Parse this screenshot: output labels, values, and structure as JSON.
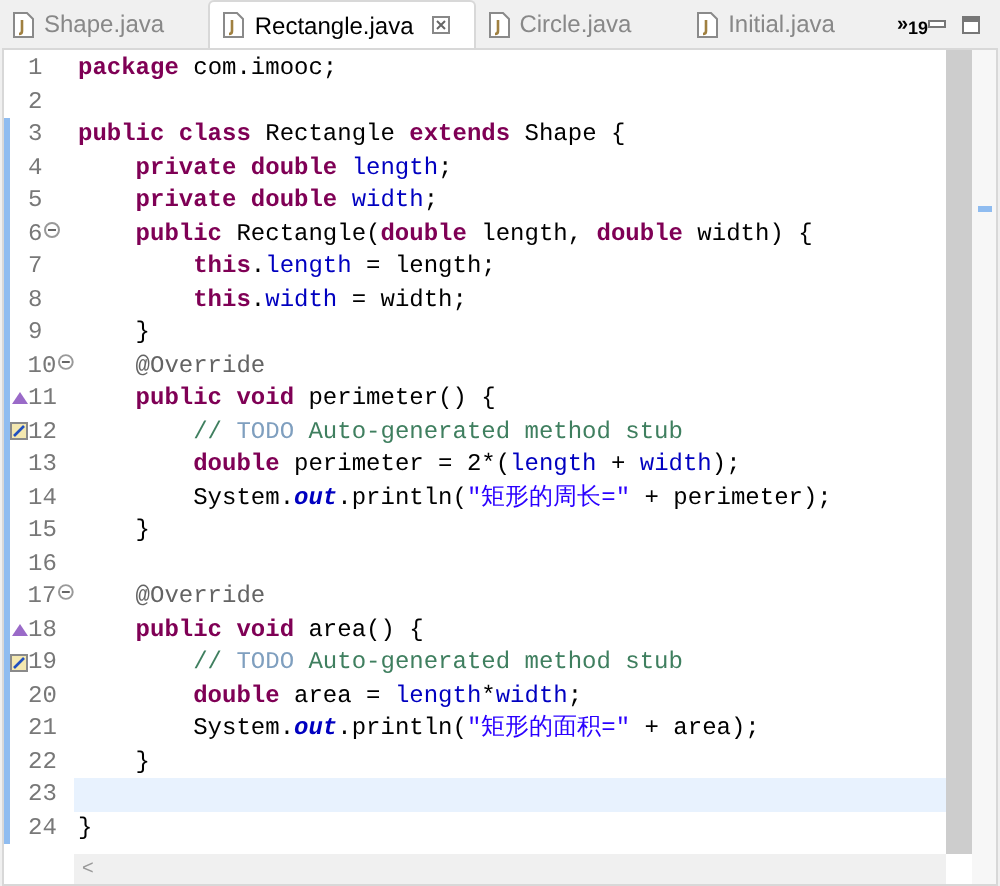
{
  "tabs": [
    {
      "label": "Shape.java",
      "selected": false,
      "closable": false
    },
    {
      "label": "Rectangle.java",
      "selected": true,
      "closable": true
    },
    {
      "label": "Circle.java",
      "selected": false,
      "closable": false
    },
    {
      "label": "Initial.java",
      "selected": false,
      "closable": false
    }
  ],
  "overflow": {
    "symbol": "»",
    "count": "19"
  },
  "lines": [
    {
      "number": "1",
      "foldable": false,
      "changed": false,
      "current": false,
      "tokens": [
        {
          "kind": "kw",
          "text": "package"
        },
        {
          "kind": "plain",
          "text": " com.imooc;"
        }
      ]
    },
    {
      "number": "2",
      "foldable": false,
      "changed": false,
      "current": false
    },
    {
      "number": "3",
      "foldable": false,
      "changed": true,
      "current": false,
      "tokens": [
        {
          "kind": "kw",
          "text": "public class"
        },
        {
          "kind": "plain",
          "text": " Rectangle "
        },
        {
          "kind": "kw",
          "text": "extends"
        },
        {
          "kind": "plain",
          "text": " Shape {"
        }
      ]
    },
    {
      "number": "4",
      "foldable": false,
      "changed": true,
      "current": false,
      "tokens": [
        {
          "kind": "kw",
          "text": "    private double"
        },
        {
          "kind": "field",
          "text": " length"
        },
        {
          "kind": "plain",
          "text": ";"
        }
      ]
    },
    {
      "number": "5",
      "foldable": false,
      "changed": true,
      "current": false,
      "tokens": [
        {
          "kind": "kw",
          "text": "    private double"
        },
        {
          "kind": "field",
          "text": " width"
        },
        {
          "kind": "plain",
          "text": ";"
        }
      ]
    },
    {
      "number": "6",
      "foldable": true,
      "changed": true,
      "current": false,
      "tokens": [
        {
          "kind": "kw",
          "text": "    public"
        },
        {
          "kind": "plain",
          "text": " Rectangle("
        },
        {
          "kind": "kw",
          "text": "double"
        },
        {
          "kind": "plain",
          "text": " length, "
        },
        {
          "kind": "kw",
          "text": "double"
        },
        {
          "kind": "plain",
          "text": " width) {"
        }
      ]
    },
    {
      "number": "7",
      "foldable": false,
      "changed": true,
      "current": false,
      "tokens": [
        {
          "kind": "kw",
          "text": "        this"
        },
        {
          "kind": "plain",
          "text": "."
        },
        {
          "kind": "field",
          "text": "length"
        },
        {
          "kind": "plain",
          "text": " = length;"
        }
      ]
    },
    {
      "number": "8",
      "foldable": false,
      "changed": true,
      "current": false,
      "tokens": [
        {
          "kind": "kw",
          "text": "        this"
        },
        {
          "kind": "plain",
          "text": "."
        },
        {
          "kind": "field",
          "text": "width"
        },
        {
          "kind": "plain",
          "text": " = width;"
        }
      ]
    },
    {
      "number": "9",
      "foldable": false,
      "changed": true,
      "current": false,
      "tokens": [
        {
          "kind": "plain",
          "text": "    }"
        }
      ]
    },
    {
      "number": "10",
      "foldable": true,
      "changed": true,
      "current": false,
      "tokens": [
        {
          "kind": "annotation",
          "text": "    @Override"
        }
      ]
    },
    {
      "number": "11",
      "foldable": false,
      "kind": "override",
      "changed": true,
      "current": false,
      "tokens": [
        {
          "kind": "kw",
          "text": "    public void"
        },
        {
          "kind": "plain",
          "text": " perimeter() {"
        }
      ]
    },
    {
      "number": "12",
      "foldable": false,
      "kind": "task",
      "changed": true,
      "current": false,
      "tokens": [
        {
          "kind": "comment",
          "text": "        //"
        },
        {
          "kind": "todo",
          "text": " TODO"
        },
        {
          "kind": "comment",
          "text": " Auto-generated method stub"
        }
      ]
    },
    {
      "number": "13",
      "foldable": false,
      "changed": true,
      "current": false,
      "tokens": [
        {
          "kind": "kw",
          "text": "        double"
        },
        {
          "kind": "plain",
          "text": " perimeter = 2*("
        },
        {
          "kind": "field",
          "text": "length"
        },
        {
          "kind": "plain",
          "text": " + "
        },
        {
          "kind": "field",
          "text": "width"
        },
        {
          "kind": "plain",
          "text": ");"
        }
      ]
    },
    {
      "number": "14",
      "foldable": false,
      "changed": true,
      "current": false,
      "tokens": [
        {
          "kind": "plain",
          "text": "        System."
        },
        {
          "kind": "static",
          "text": "out"
        },
        {
          "kind": "plain",
          "text": ".println("
        },
        {
          "kind": "str",
          "text": "\"矩形的周长=\""
        },
        {
          "kind": "plain",
          "text": " + perimeter);"
        }
      ]
    },
    {
      "number": "15",
      "foldable": false,
      "changed": true,
      "current": false,
      "tokens": [
        {
          "kind": "plain",
          "text": "    }"
        }
      ]
    },
    {
      "number": "16",
      "foldable": false,
      "changed": true,
      "current": false
    },
    {
      "number": "17",
      "foldable": true,
      "changed": true,
      "current": false,
      "tokens": [
        {
          "kind": "annotation",
          "text": "    @Override"
        }
      ]
    },
    {
      "number": "18",
      "foldable": false,
      "kind": "override",
      "changed": true,
      "current": false,
      "tokens": [
        {
          "kind": "kw",
          "text": "    public void"
        },
        {
          "kind": "plain",
          "text": " area() {"
        }
      ]
    },
    {
      "number": "19",
      "foldable": false,
      "kind": "task",
      "changed": true,
      "current": false,
      "tokens": [
        {
          "kind": "comment",
          "text": "        //"
        },
        {
          "kind": "todo",
          "text": " TODO"
        },
        {
          "kind": "comment",
          "text": " Auto-generated method stub"
        }
      ]
    },
    {
      "number": "20",
      "foldable": false,
      "changed": true,
      "current": false,
      "tokens": [
        {
          "kind": "kw",
          "text": "        double"
        },
        {
          "kind": "plain",
          "text": " area = "
        },
        {
          "kind": "field",
          "text": "length"
        },
        {
          "kind": "plain",
          "text": "*"
        },
        {
          "kind": "field",
          "text": "width"
        },
        {
          "kind": "plain",
          "text": ";"
        }
      ]
    },
    {
      "number": "21",
      "foldable": false,
      "changed": true,
      "current": false,
      "tokens": [
        {
          "kind": "plain",
          "text": "        System."
        },
        {
          "kind": "static",
          "text": "out"
        },
        {
          "kind": "plain",
          "text": ".println("
        },
        {
          "kind": "str",
          "text": "\"矩形的面积=\""
        },
        {
          "kind": "plain",
          "text": " + area);"
        }
      ]
    },
    {
      "number": "22",
      "foldable": false,
      "changed": true,
      "current": false,
      "tokens": [
        {
          "kind": "plain",
          "text": "    }"
        }
      ]
    },
    {
      "number": "23",
      "foldable": false,
      "changed": true,
      "current": true
    },
    {
      "number": "24",
      "foldable": false,
      "changed": true,
      "current": false,
      "tokens": [
        {
          "kind": "plain",
          "text": "}"
        }
      ]
    }
  ],
  "scroll_left": "<"
}
